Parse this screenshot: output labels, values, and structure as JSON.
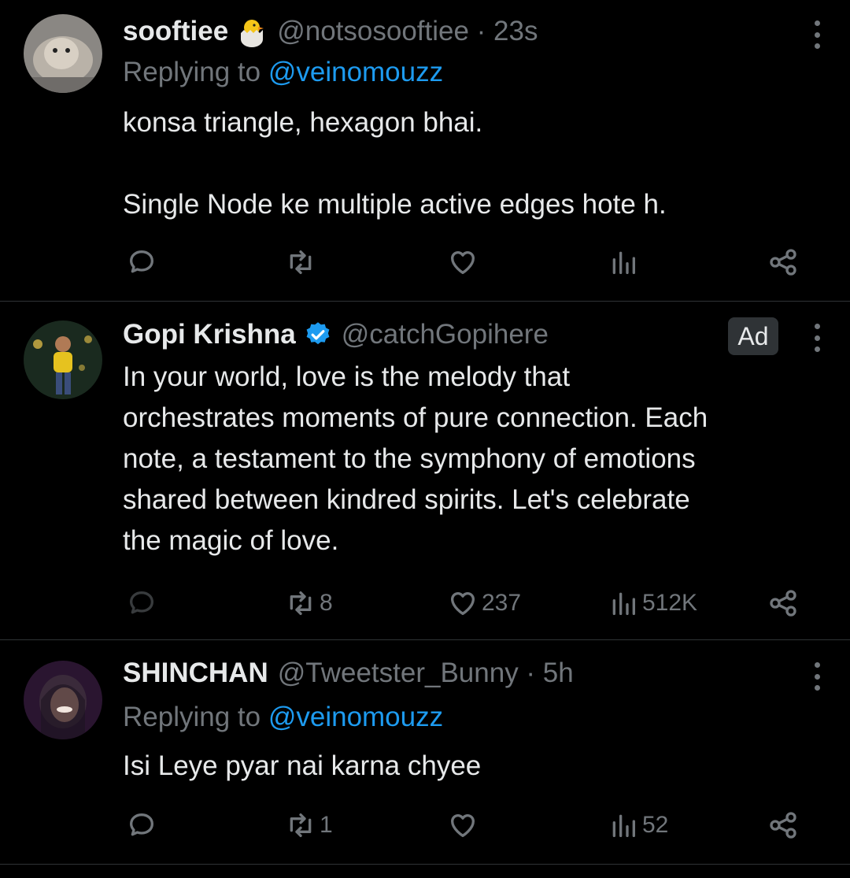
{
  "tweets": [
    {
      "name": "sooftiee",
      "handle": "@notsosooftiee · 23s",
      "replying_prefix": "Replying to ",
      "replying_to": "@veinomouzz",
      "text": "konsa triangle, hexagon bhai.\n\nSingle Node ke multiple active edges hote h.",
      "reply_count": "",
      "retweet_count": "",
      "like_count": "",
      "view_count": ""
    },
    {
      "name": "Gopi Krishna",
      "handle": "@catchGopihere",
      "ad_label": "Ad",
      "text": "In your world, love is the melody that\norchestrates moments of pure connection. Each\nnote, a testament to the symphony of emotions\nshared between kindred spirits. Let's celebrate\nthe magic of love.",
      "reply_count": "",
      "retweet_count": "8",
      "like_count": "237",
      "view_count": "512K"
    },
    {
      "name": "SHINCHAN",
      "handle": "@Tweetster_Bunny · 5h",
      "replying_prefix": "Replying to ",
      "replying_to": "@veinomouzz",
      "text": "Isi Leye pyar nai karna chyee",
      "reply_count": "",
      "retweet_count": "1",
      "like_count": "",
      "view_count": "52"
    }
  ],
  "colors": {
    "background": "#000000",
    "text": "#e7e9ea",
    "muted": "#71767b",
    "link": "#1d9bf0",
    "divider": "#2f3336",
    "verified": "#1d9bf0"
  }
}
